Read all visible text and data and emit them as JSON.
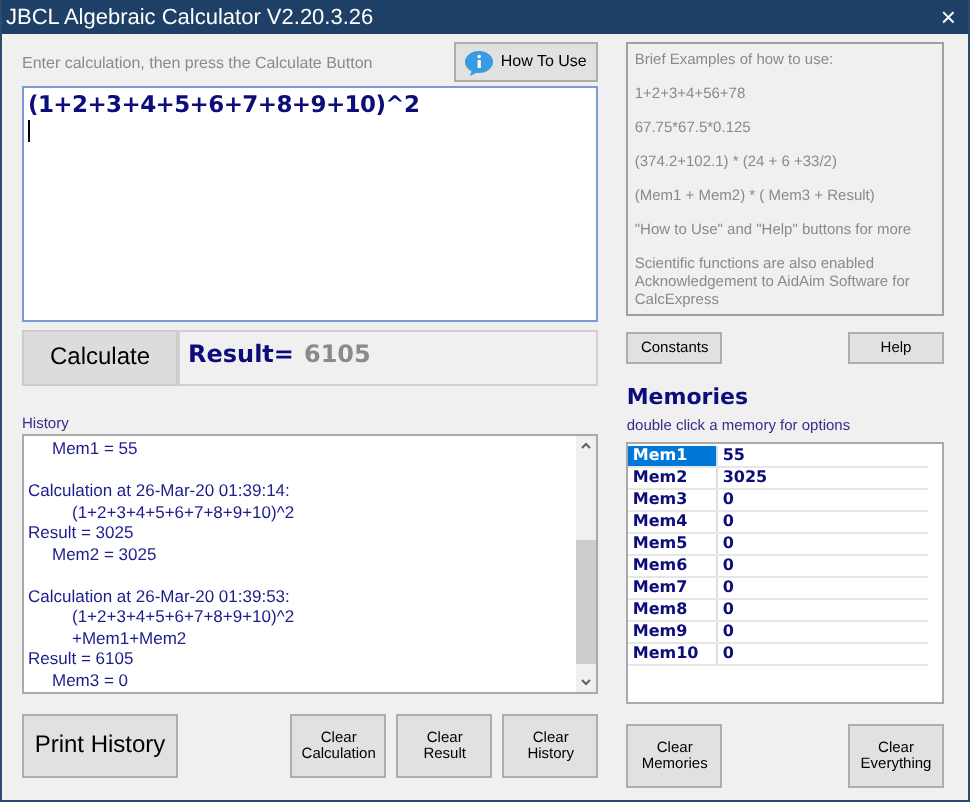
{
  "window": {
    "title": "JBCL Algebraic Calculator V2.20.3.26",
    "close": "×"
  },
  "hint": "Enter calculation, then press the Calculate Button",
  "how_to_use_button": "How To Use",
  "expression": "(1+2+3+4+5+6+7+8+9+10)^2",
  "calculate_button": "Calculate",
  "result_label": "Result=",
  "result_value": "6105",
  "examples": {
    "lines": [
      "Brief Examples of how to use:",
      "1+2+3+4+56+78",
      "67.75*67.5*0.125",
      "(374.2+102.1) * (24 + 6 +33/2)",
      "(Mem1 + Mem2) * ( Mem3 + Result)",
      "\"How to Use\" and \"Help\" buttons for more",
      "Scientific functions are also enabled\nAcknowledgement to AidAim Software for CalcExpress"
    ]
  },
  "constants_button": "Constants",
  "help_button": "Help",
  "history": {
    "label": "History",
    "entries": [
      {
        "lines": [
          {
            "kind": "memory",
            "text": "Mem1 = 55"
          }
        ]
      },
      {
        "lines": [
          {
            "kind": "plain",
            "text": "Calculation at 26-Mar-20 01:39:14:"
          },
          {
            "kind": "expression",
            "text": "(1+2+3+4+5+6+7+8+9+10)^2"
          },
          {
            "kind": "plain",
            "text": "Result = 3025"
          },
          {
            "kind": "memory",
            "text": "Mem2 = 3025"
          }
        ]
      },
      {
        "lines": [
          {
            "kind": "plain",
            "text": "Calculation at 26-Mar-20 01:39:53:"
          },
          {
            "kind": "expression",
            "text": "(1+2+3+4+5+6+7+8+9+10)^2"
          },
          {
            "kind": "expression",
            "text": "+Mem1+Mem2"
          },
          {
            "kind": "plain",
            "text": "Result = 6105"
          },
          {
            "kind": "memory",
            "text": "Mem3 = 0"
          }
        ]
      }
    ]
  },
  "memories": {
    "title": "Memories",
    "subtitle": "double click a memory for options",
    "rows": [
      {
        "name": "Mem1",
        "value": "55",
        "selected": true
      },
      {
        "name": "Mem2",
        "value": "3025",
        "selected": false
      },
      {
        "name": "Mem3",
        "value": "0",
        "selected": false
      },
      {
        "name": "Mem4",
        "value": "0",
        "selected": false
      },
      {
        "name": "Mem5",
        "value": "0",
        "selected": false
      },
      {
        "name": "Mem6",
        "value": "0",
        "selected": false
      },
      {
        "name": "Mem7",
        "value": "0",
        "selected": false
      },
      {
        "name": "Mem8",
        "value": "0",
        "selected": false
      },
      {
        "name": "Mem9",
        "value": "0",
        "selected": false
      },
      {
        "name": "Mem10",
        "value": "0",
        "selected": false
      }
    ]
  },
  "bottom_buttons": {
    "print_history": "Print History",
    "clear": [
      {
        "text": "Clear\nCalculation"
      },
      {
        "text": "Clear\nResult"
      },
      {
        "text": "Clear\nHistory"
      }
    ],
    "clear_memories": "Clear\nMemories",
    "clear_everything": "Clear\nEverything"
  }
}
